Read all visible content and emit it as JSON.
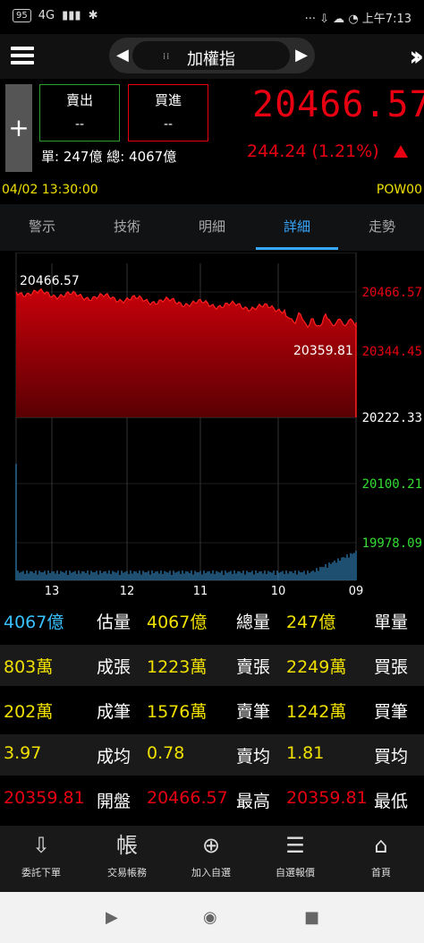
{
  "status": {
    "time": "上午7:13",
    "battery": "95",
    "signal": "4G",
    "icons": [
      "notify-icon",
      "bluetooth-icon",
      "wifi-icon",
      "alarm-icon"
    ]
  },
  "header": {
    "title": "加權指",
    "prev_arrow": "◀",
    "next_arrow": "▶"
  },
  "quote": {
    "sell_label": "賣出",
    "sell_value": "--",
    "buy_label": "買進",
    "buy_value": "--",
    "volume_text": "單: 247億  總: 4067億",
    "price": "20466.57",
    "change": "244.24 (1.21%)"
  },
  "timerow": {
    "left": "04/02 13:30:00",
    "right": "POW00"
  },
  "tabs": [
    {
      "label": "走勢"
    },
    {
      "label": "詳細"
    },
    {
      "label": "明細"
    },
    {
      "label": "技術"
    },
    {
      "label": "警示"
    }
  ],
  "chart_data": {
    "type": "area",
    "price_labels": [
      "20466.57",
      "20344.45",
      "20222.33",
      "20100.21",
      "19978.09"
    ],
    "x_labels": [
      "09",
      "10",
      "11",
      "12",
      "13"
    ],
    "annotations": {
      "high": "20466.57",
      "low": "20359.81"
    }
  },
  "table": [
    [
      {
        "t": "單量",
        "c": "#ffffff"
      },
      {
        "t": "247億",
        "c": "#f0e000"
      },
      {
        "t": "總量",
        "c": "#ffffff"
      },
      {
        "t": "4067億",
        "c": "#f0e000"
      },
      {
        "t": "估量",
        "c": "#ffffff"
      },
      {
        "t": "4067億",
        "c": "#38c0ff"
      }
    ],
    [
      {
        "t": "買張",
        "c": "#ffffff"
      },
      {
        "t": "2249萬",
        "c": "#f0e000"
      },
      {
        "t": "賣張",
        "c": "#ffffff"
      },
      {
        "t": "1223萬",
        "c": "#f0e000"
      },
      {
        "t": "成張",
        "c": "#ffffff"
      },
      {
        "t": "803萬",
        "c": "#f0e000"
      }
    ],
    [
      {
        "t": "買筆",
        "c": "#ffffff"
      },
      {
        "t": "1242萬",
        "c": "#f0e000"
      },
      {
        "t": "賣筆",
        "c": "#ffffff"
      },
      {
        "t": "1576萬",
        "c": "#f0e000"
      },
      {
        "t": "成筆",
        "c": "#ffffff"
      },
      {
        "t": "202萬",
        "c": "#f0e000"
      }
    ],
    [
      {
        "t": "買均",
        "c": "#ffffff"
      },
      {
        "t": "1.81",
        "c": "#f0e000"
      },
      {
        "t": "賣均",
        "c": "#ffffff"
      },
      {
        "t": "0.78",
        "c": "#f0e000"
      },
      {
        "t": "成均",
        "c": "#ffffff"
      },
      {
        "t": "3.97",
        "c": "#f0e000"
      }
    ],
    [
      {
        "t": "最低",
        "c": "#ffffff"
      },
      {
        "t": "20359.81",
        "c": "#e60012"
      },
      {
        "t": "最高",
        "c": "#ffffff"
      },
      {
        "t": "20466.57",
        "c": "#e60012"
      },
      {
        "t": "開盤",
        "c": "#ffffff"
      },
      {
        "t": "20359.81",
        "c": "#e60012"
      }
    ]
  ],
  "nav": [
    {
      "label": "首頁",
      "icon": "home-icon",
      "glyph": "⌂"
    },
    {
      "label": "自選報價",
      "icon": "list-icon",
      "glyph": "☰"
    },
    {
      "label": "加入自選",
      "icon": "add-circle-icon",
      "glyph": "⊕"
    },
    {
      "label": "交易帳務",
      "icon": "account-icon",
      "glyph": "帳"
    },
    {
      "label": "委託下單",
      "icon": "order-icon",
      "glyph": "⇩"
    }
  ],
  "colors": {
    "up": "#e60012",
    "yellow": "#f0e000",
    "accent": "#38a8ff"
  }
}
